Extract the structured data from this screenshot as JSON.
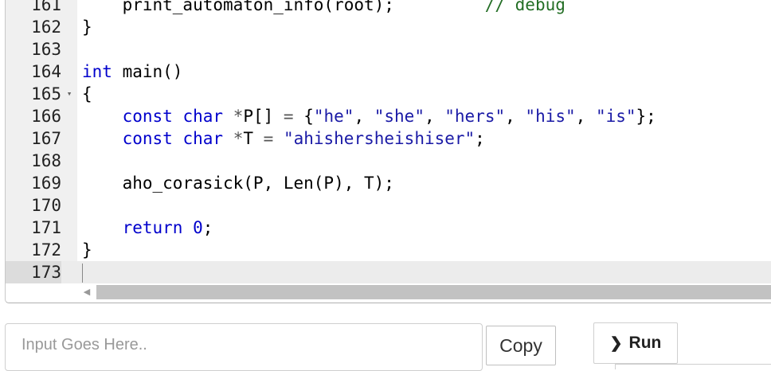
{
  "editor": {
    "lines": [
      {
        "num": "161",
        "code": [
          {
            "t": "    print_automaton_info(root);"
          },
          {
            "t": "         "
          },
          {
            "t": "// debug",
            "c": "cm"
          }
        ]
      },
      {
        "num": "162",
        "code": [
          {
            "t": "}"
          }
        ]
      },
      {
        "num": "163",
        "code": []
      },
      {
        "num": "164",
        "code": [
          {
            "t": "int",
            "c": "kw"
          },
          {
            "t": " main()"
          }
        ]
      },
      {
        "num": "165",
        "fold": true,
        "code": [
          {
            "t": "{"
          }
        ]
      },
      {
        "num": "166",
        "code": [
          {
            "t": "    "
          },
          {
            "t": "const",
            "c": "kw"
          },
          {
            "t": " "
          },
          {
            "t": "char",
            "c": "kw"
          },
          {
            "t": " "
          },
          {
            "t": "*",
            "c": "op"
          },
          {
            "t": "P[] "
          },
          {
            "t": "=",
            "c": "op"
          },
          {
            "t": " {"
          },
          {
            "t": "\"he\"",
            "c": "str"
          },
          {
            "t": ", "
          },
          {
            "t": "\"she\"",
            "c": "str"
          },
          {
            "t": ", "
          },
          {
            "t": "\"hers\"",
            "c": "str"
          },
          {
            "t": ", "
          },
          {
            "t": "\"his\"",
            "c": "str"
          },
          {
            "t": ", "
          },
          {
            "t": "\"is\"",
            "c": "str"
          },
          {
            "t": "};"
          }
        ]
      },
      {
        "num": "167",
        "code": [
          {
            "t": "    "
          },
          {
            "t": "const",
            "c": "kw"
          },
          {
            "t": " "
          },
          {
            "t": "char",
            "c": "kw"
          },
          {
            "t": " "
          },
          {
            "t": "*",
            "c": "op"
          },
          {
            "t": "T "
          },
          {
            "t": "=",
            "c": "op"
          },
          {
            "t": " "
          },
          {
            "t": "\"ahishersheishiser\"",
            "c": "str"
          },
          {
            "t": ";"
          }
        ]
      },
      {
        "num": "168",
        "code": []
      },
      {
        "num": "169",
        "code": [
          {
            "t": "    aho_corasick(P, Len(P), T);"
          }
        ]
      },
      {
        "num": "170",
        "code": []
      },
      {
        "num": "171",
        "code": [
          {
            "t": "    "
          },
          {
            "t": "return",
            "c": "kw"
          },
          {
            "t": " "
          },
          {
            "t": "0",
            "c": "num"
          },
          {
            "t": ";"
          }
        ]
      },
      {
        "num": "172",
        "code": [
          {
            "t": "}"
          }
        ]
      },
      {
        "num": "173",
        "active": true,
        "code": []
      }
    ]
  },
  "input": {
    "placeholder": "Input Goes Here.."
  },
  "buttons": {
    "copy": "Copy",
    "run": "Run"
  }
}
